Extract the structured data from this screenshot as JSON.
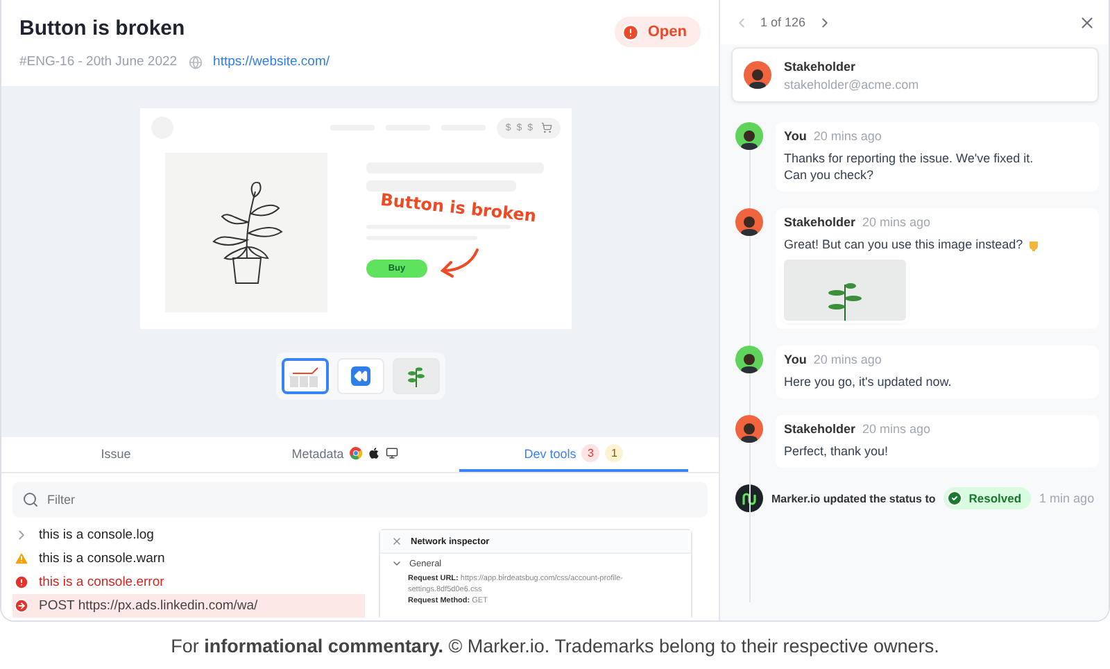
{
  "issue": {
    "title": "Button is broken",
    "status": {
      "label": "Open",
      "kind": "open"
    },
    "reference": "#ENG-16 - 20th June 2022",
    "url": "https://website.com/"
  },
  "preview": {
    "price": "$ $ $",
    "annotation": "Button is broken",
    "buy_button": "Buy",
    "thumbnails": [
      {
        "kind": "annotated",
        "selected": true
      },
      {
        "kind": "video",
        "selected": false
      },
      {
        "kind": "photo",
        "selected": false
      }
    ]
  },
  "tabs": [
    {
      "label": "Issue",
      "kind": "plain",
      "selected": false
    },
    {
      "label": "Metadata",
      "kind": "metadata",
      "selected": false
    },
    {
      "label": "Dev tools",
      "kind": "devtools",
      "selected": true,
      "badges": [
        {
          "count": "3",
          "kind": "error"
        },
        {
          "count": "1",
          "kind": "warning"
        }
      ]
    }
  ],
  "filter": {
    "placeholder": "Filter"
  },
  "console": [
    {
      "kind": "log",
      "text": "this is a console.log"
    },
    {
      "kind": "warn",
      "text": "this is a console.warn"
    },
    {
      "kind": "error",
      "text": "this is a console.error"
    },
    {
      "kind": "network",
      "text": "POST https://px.ads.linkedin.com/wa/"
    }
  ],
  "network_inspector": {
    "title": "Network inspector",
    "section": {
      "label": "General",
      "expanded": true
    },
    "fields": [
      {
        "label": "Request URL:",
        "value": "https://app.birdeatsbug.com/css/account-profile-settings.8df5d0e6.css"
      },
      {
        "label": "Request Method:",
        "value": "GET"
      }
    ]
  },
  "pager": {
    "label": "1 of 126"
  },
  "reporter": {
    "name": "Stakeholder",
    "email": "stakeholder@acme.com"
  },
  "messages": [
    {
      "author": "You",
      "kind": "you",
      "time": "20 mins ago",
      "text": "Thanks for reporting the issue. We've fixed it.\nCan you check?"
    },
    {
      "author": "Stakeholder",
      "kind": "stakeholder",
      "time": "20 mins ago",
      "text": "Great! But can you use this image instead?",
      "pointing": true,
      "attachment": {
        "kind": "image"
      }
    },
    {
      "author": "You",
      "kind": "you",
      "time": "20 mins ago",
      "text": "Here you go, it's updated now."
    },
    {
      "author": "Stakeholder",
      "kind": "stakeholder",
      "time": "20 mins ago",
      "text": "Perfect, thank you!"
    }
  ],
  "activity": {
    "text": "Marker.io updated the status to",
    "status": {
      "label": "Resolved",
      "kind": "resolved"
    },
    "time": "1 min ago"
  },
  "caption": "For **informational commentary.** © Marker.io. Trademarks belong to their respective owners."
}
